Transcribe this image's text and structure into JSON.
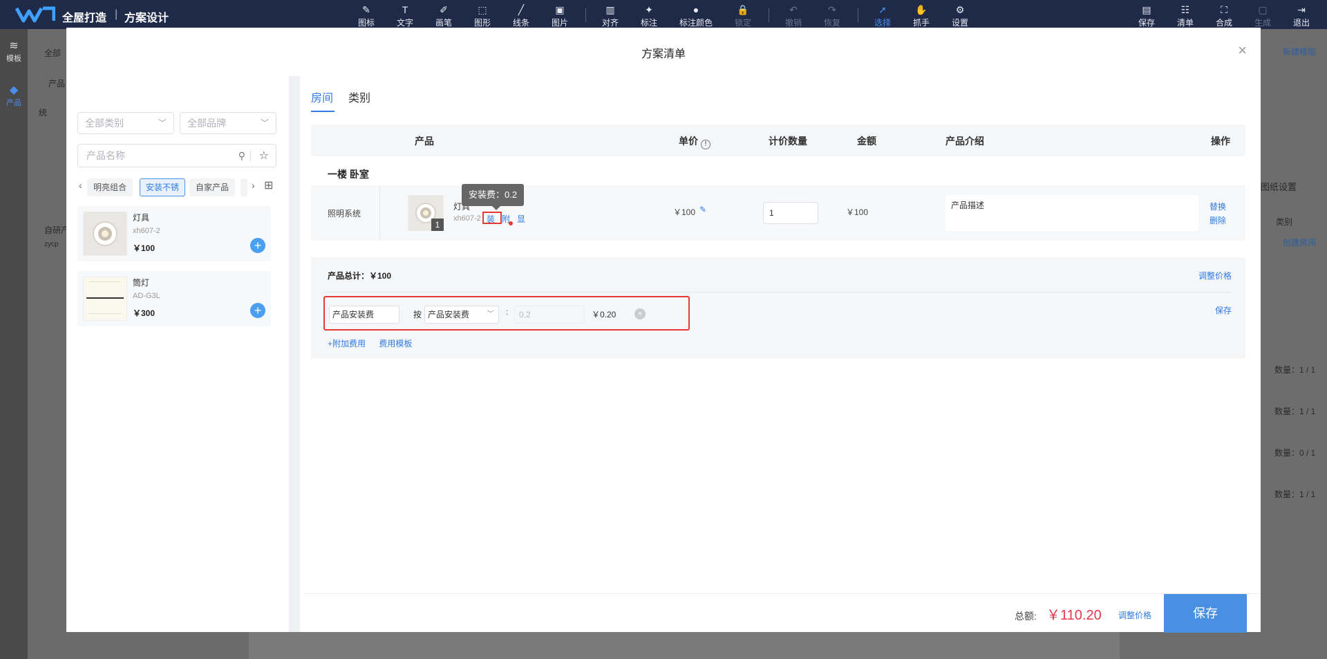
{
  "app": {
    "brand": "全屋打造",
    "separator": "|",
    "subtitle": "方案设计"
  },
  "toolbar": {
    "left_tools": [
      {
        "label": "图标",
        "icon": "✎"
      },
      {
        "label": "文字",
        "icon": "T"
      },
      {
        "label": "画笔",
        "icon": "✐"
      },
      {
        "label": "图形",
        "icon": "⬚"
      },
      {
        "label": "线条",
        "icon": "╱"
      },
      {
        "label": "图片",
        "icon": "▣"
      },
      {
        "label": "对齐",
        "icon": "▥"
      },
      {
        "label": "标注",
        "icon": "✦"
      },
      {
        "label": "标注颜色",
        "icon": "●"
      },
      {
        "label": "锁定",
        "icon": "🔒"
      },
      {
        "label": "撤销",
        "icon": "↶"
      },
      {
        "label": "恢复",
        "icon": "↷"
      },
      {
        "label": "选择",
        "icon": "➚"
      },
      {
        "label": "抓手",
        "icon": "✋"
      },
      {
        "label": "设置",
        "icon": "⚙"
      }
    ],
    "right_tools": [
      {
        "label": "保存",
        "icon": "▤"
      },
      {
        "label": "清单",
        "icon": "☷"
      },
      {
        "label": "合成",
        "icon": "⛶"
      },
      {
        "label": "生成",
        "icon": "▢"
      },
      {
        "label": "退出",
        "icon": "⇥"
      }
    ]
  },
  "rail": {
    "template": "模板",
    "product": "产品"
  },
  "background": {
    "all_label": "全部",
    "product_label": "产品",
    "back_label": "统",
    "self_product": "自研产",
    "zycp": "zycp",
    "new_floor": "新建楼层",
    "drawing_settings": "图纸设置",
    "category": "类别",
    "create_room": "创建房间",
    "counts": [
      "数量：1 / 1",
      "数量：1 / 1",
      "数量：0 / 1",
      "数量：1 / 1"
    ]
  },
  "modal": {
    "title": "方案清单",
    "close": "×"
  },
  "left_panel": {
    "category_select": "全部类别",
    "brand_select": "全部品牌",
    "search_placeholder": "产品名称",
    "chips": [
      "明亮组合",
      "安装不锈",
      "自家产品"
    ],
    "products": [
      {
        "name": "灯具",
        "code": "xh607-2",
        "price": "￥100"
      },
      {
        "name": "筒灯",
        "code": "AD-G3L",
        "price": "￥300"
      }
    ],
    "add": "+"
  },
  "tabs": {
    "room": "房间",
    "category": "类别"
  },
  "table": {
    "headers": {
      "product": "产品",
      "unit_price": "单价",
      "qty": "计价数量",
      "amount": "金额",
      "intro": "产品介绍",
      "ops": "操作"
    },
    "info_icon": "!",
    "room_name": "一楼 卧室",
    "row": {
      "system": "照明系统",
      "badge": "1",
      "name": "灯具",
      "code": "xh607-2",
      "tag_install": "装",
      "tag_attach": "附",
      "tag_show": "显",
      "unit_price": "￥100",
      "qty": "1",
      "amount": "￥100",
      "description": "产品描述",
      "replace": "替换",
      "delete": "删除"
    },
    "tooltip": "安装费：0.2"
  },
  "summary": {
    "title": "产品总计：￥100",
    "adjust": "调整价格",
    "fee_name": "产品安装费",
    "by": "按",
    "fee_type": "产品安装费",
    "colon": ":",
    "rate_placeholder": "0.2",
    "fee_amount": "￥0.20",
    "remove": "×",
    "save": "保存",
    "add_fee": "+附加费用",
    "fee_template": "费用模板"
  },
  "footer": {
    "total_label": "总额:",
    "total": "￥110.20",
    "adjust": "调整价格",
    "save": "保存"
  },
  "colors": {
    "topbar": "#1e2a47",
    "accent": "#2f7be5",
    "highlight_border": "#e53935",
    "total": "#e8364a",
    "save_button": "#4a90e2"
  }
}
